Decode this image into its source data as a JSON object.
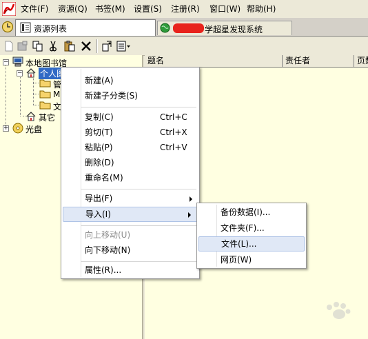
{
  "menubar": {
    "items": [
      "文件(F)",
      "资源(Q)",
      "书签(M)",
      "设置(S)",
      "注册(R)",
      "窗口(W)",
      "帮助(H)"
    ]
  },
  "tabs": [
    {
      "label": "资源列表"
    },
    {
      "label": "学超星发现系统"
    }
  ],
  "tree": {
    "root": "本地图书馆",
    "personal": "个人图书馆",
    "children": [
      "管",
      "M",
      "文"
    ],
    "other": "其它",
    "disc": "光盘"
  },
  "table": {
    "columns": [
      "题名",
      "责任者",
      "页数"
    ]
  },
  "context_menu": {
    "items": [
      {
        "label": "新建(A)"
      },
      {
        "label": "新建子分类(S)"
      },
      {
        "label": "复制(C)",
        "shortcut": "Ctrl+C"
      },
      {
        "label": "剪切(T)",
        "shortcut": "Ctrl+X"
      },
      {
        "label": "粘贴(P)",
        "shortcut": "Ctrl+V"
      },
      {
        "label": "删除(D)"
      },
      {
        "label": "重命名(M)"
      },
      {
        "label": "导出(F)"
      },
      {
        "label": "导入(I)"
      },
      {
        "label": "向上移动(U)"
      },
      {
        "label": "向下移动(N)"
      },
      {
        "label": "属性(R)..."
      }
    ]
  },
  "import_submenu": {
    "items": [
      {
        "label": "备份数据(I)..."
      },
      {
        "label": "文件夹(F)..."
      },
      {
        "label": "文件(L)..."
      },
      {
        "label": "网页(W)"
      }
    ]
  },
  "colors": {
    "tree_background": "#ffffe1",
    "menu_highlight": "#e0e8f6",
    "selection": "#316ac5"
  }
}
